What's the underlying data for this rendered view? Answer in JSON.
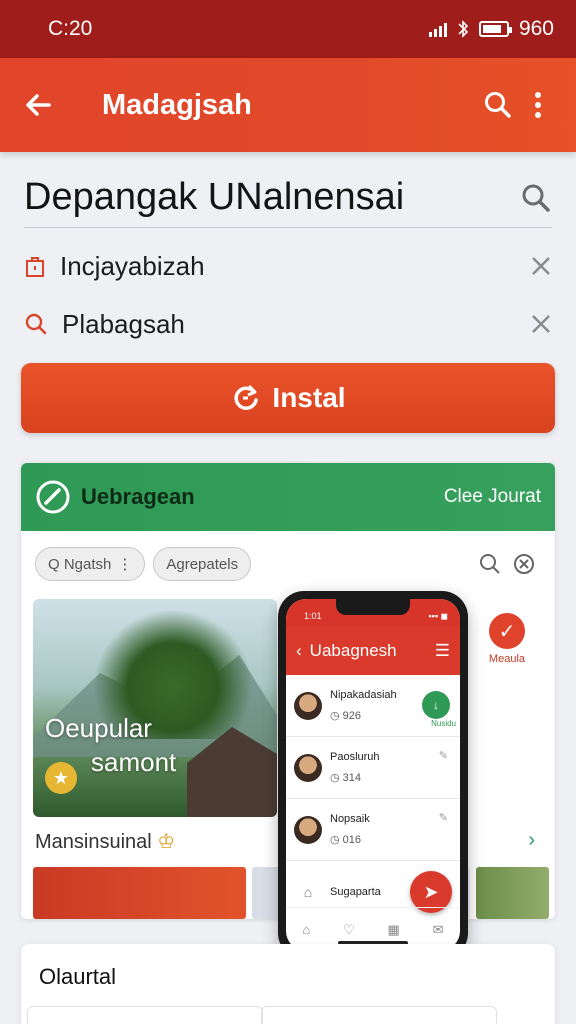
{
  "status": {
    "time": "C:20",
    "battery": "960"
  },
  "appbar": {
    "title": "Madagjsah"
  },
  "search": {
    "heading": "Depangak UNalnensai"
  },
  "filters": [
    {
      "label": "Incjayabizah"
    },
    {
      "label": "Plabagsah"
    }
  ],
  "install": {
    "label": "Instal"
  },
  "preview": {
    "app_name": "Uebragean",
    "header_right": "Clee Jourat",
    "pills": [
      "Q Ngatsh",
      "Agrepatels"
    ],
    "hero_line1": "Oeupular",
    "hero_line2": "samont",
    "section_label": "Mansinsuinal",
    "side_caption": "Meaula"
  },
  "phone": {
    "status_left": "1:01",
    "status_right": "▪▪▪ ◼",
    "title": "Uabagnesh",
    "rows": [
      {
        "name": "Nipakadasiah",
        "stat": "◷ 926",
        "tag": "Nusidu"
      },
      {
        "name": "Paosluruh",
        "stat": "◷ 314",
        "tag": ""
      },
      {
        "name": "Nopsaik",
        "stat": "◷ 016",
        "tag": ""
      },
      {
        "name": "Sugaparta",
        "stat": "",
        "tag": ""
      }
    ]
  },
  "bottom": {
    "title": "Olaurtal"
  }
}
